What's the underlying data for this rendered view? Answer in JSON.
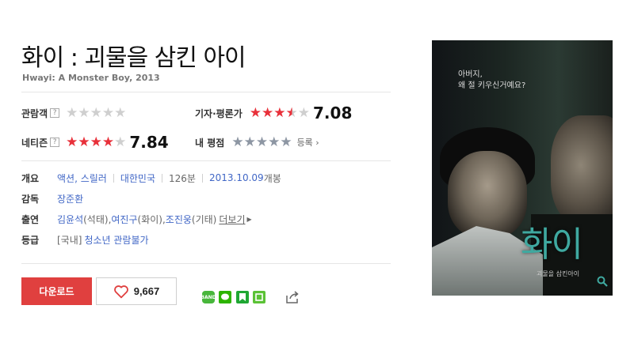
{
  "movie": {
    "title": "화이 : 괴물을 삼킨 아이",
    "original_title": "Hwayi: A Monster Boy, 2013"
  },
  "ratings": {
    "audience": {
      "label": "관람객",
      "help": "?",
      "stars": 0,
      "max_stars": 5
    },
    "critics": {
      "label": "기자·평론가",
      "help": "?",
      "stars": 3.5,
      "max_stars": 5,
      "score": "7.08"
    },
    "netizen": {
      "label": "네티즌",
      "help": "?",
      "stars": 4,
      "max_stars": 5,
      "score": "7.84"
    },
    "mine": {
      "label": "내 평점",
      "stars": 0,
      "max_stars": 5,
      "link": "등록"
    }
  },
  "details": {
    "overview": {
      "label": "개요",
      "genres": "액션, 스릴러",
      "country": "대한민국",
      "runtime": "126분",
      "release_date": "2013.10.09",
      "release_suffix": "개봉"
    },
    "director": {
      "label": "감독",
      "name": "장준환"
    },
    "cast": {
      "label": "출연",
      "actors": [
        "김윤석",
        "여진구",
        "조진웅"
      ],
      "roles": [
        "(석태), ",
        "(화이), ",
        "(기태)"
      ],
      "more": "더보기"
    },
    "rating_grade": {
      "label": "등급",
      "region": "[국내]",
      "grade": "청소년 관람불가"
    }
  },
  "actions": {
    "download_label": "다운로드",
    "like_count": "9,667"
  },
  "share_icons": [
    "band-icon",
    "line-icon",
    "bookmark-icon",
    "kakaostory-icon"
  ],
  "poster": {
    "tagline": "아버지,\n왜 절 키우신거예요?",
    "title_text": "화이",
    "subtitle_text": "괴물을 삼킨아이"
  },
  "colors": {
    "accent_red": "#e0403f",
    "star_red": "#e8303a",
    "star_gray": "#8d96a3",
    "link_blue": "#4167c6"
  }
}
